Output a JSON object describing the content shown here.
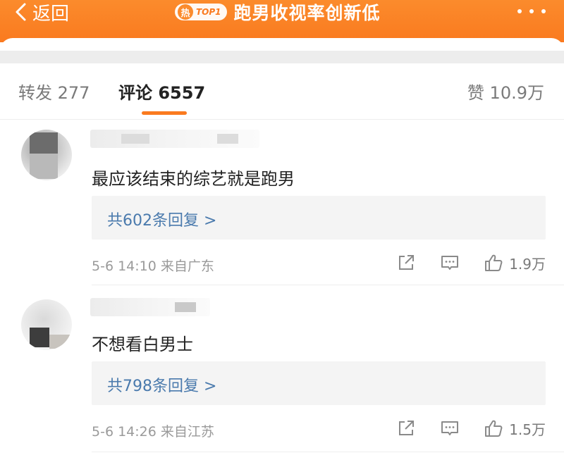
{
  "header": {
    "back_label": "返回",
    "hot_icon_text": "热",
    "rank_badge": "TOP1",
    "title": "跑男收视率创新低",
    "accent_color": "#fa7a1f"
  },
  "tabs": {
    "repost": "转发 277",
    "comment": "评论 6557",
    "like": "赞 10.9万"
  },
  "comments": [
    {
      "text": "最应该结束的综艺就是跑男",
      "replies": "共602条回复 >",
      "time_location": "5-6 14:10  来自广东",
      "likes": "1.9万"
    },
    {
      "text": "不想看白男士",
      "replies": "共798条回复 >",
      "time_location": "5-6 14:26  来自江苏",
      "likes": "1.5万"
    }
  ],
  "icons": {
    "back": "chevron-left-icon",
    "more": "more-dots-icon",
    "share": "share-icon",
    "reply": "comment-icon",
    "like": "thumbs-up-icon"
  }
}
